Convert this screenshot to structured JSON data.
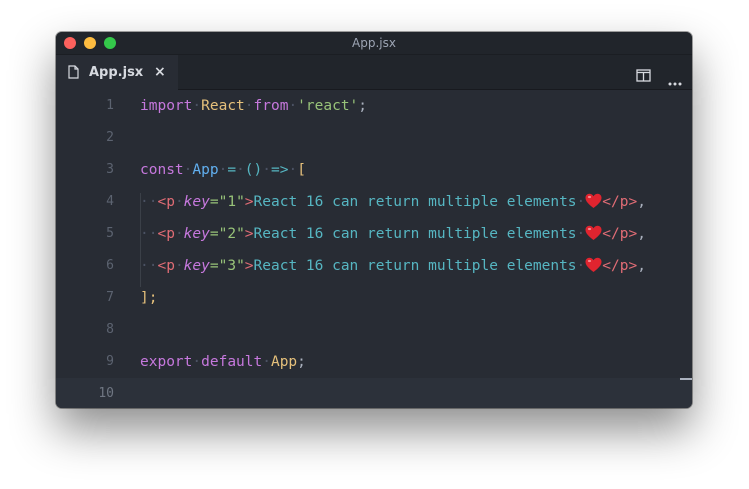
{
  "window": {
    "title": "App.jsx",
    "colors": {
      "red": "#fc615d",
      "yellow": "#fdbc40",
      "green": "#34c84a",
      "background": "#282c34"
    }
  },
  "tab": {
    "label": "App.jsx",
    "close": "×",
    "icon": "file-icon"
  },
  "toolbar": {
    "split_icon": "split-editor-icon",
    "more_icon": "more-actions-icon"
  },
  "editor": {
    "line_numbers": [
      "1",
      "2",
      "3",
      "4",
      "5",
      "6",
      "7",
      "8",
      "9",
      "10"
    ],
    "line1": {
      "t1": "import",
      "t2": "React",
      "t3": "from",
      "t4": "'react'",
      "t5": ";"
    },
    "line3": {
      "t1": "const",
      "t2": "App",
      "t3": "=",
      "t4": "()",
      "t5": "=>",
      "t6": "["
    },
    "line4": {
      "t1": "<p",
      "t2": "key",
      "t3": "=\"1\"",
      "t4": ">",
      "t5": "React 16 can return multiple elements",
      "t6": "</p>",
      "t7": ","
    },
    "line5": {
      "t1": "<p",
      "t2": "key",
      "t3": "=\"2\"",
      "t4": ">",
      "t5": "React 16 can return multiple elements",
      "t6": "</p>",
      "t7": ","
    },
    "line6": {
      "t1": "<p",
      "t2": "key",
      "t3": "=\"3\"",
      "t4": ">",
      "t5": "React 16 can return multiple elements",
      "t6": "</p>",
      "t7": ","
    },
    "line7": {
      "t1": "];"
    },
    "line9": {
      "t1": "export",
      "t2": "default",
      "t3": "App",
      "t4": ";"
    },
    "emoji_icon": "red-heart-icon"
  }
}
